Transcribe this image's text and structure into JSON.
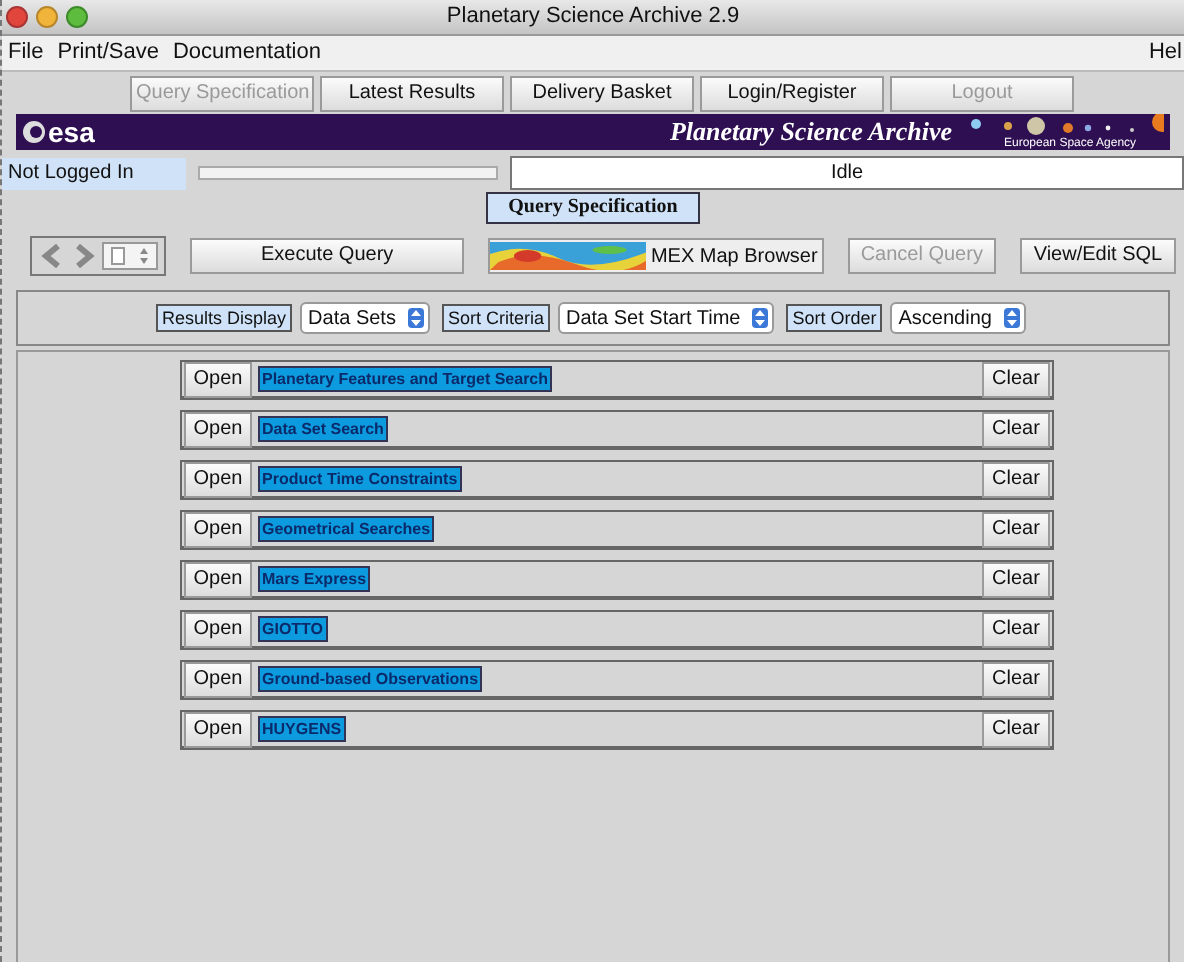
{
  "window": {
    "title": "Planetary Science Archive 2.9"
  },
  "menu": [
    {
      "label": "File"
    },
    {
      "label": "Print/Save"
    },
    {
      "label": "Documentation"
    }
  ],
  "help_menu": "Hel",
  "nav_buttons": [
    {
      "label": "Query Specification",
      "disabled": true
    },
    {
      "label": "Latest Results",
      "disabled": false
    },
    {
      "label": "Delivery Basket",
      "disabled": false
    },
    {
      "label": "Login/Register",
      "disabled": false
    },
    {
      "label": "Logout",
      "disabled": true
    }
  ],
  "banner": {
    "logo": "esa",
    "title": "Planetary Science  Archive",
    "agency": "European Space Agency"
  },
  "status": {
    "login": "Not Logged In",
    "progress": {
      "level": 0
    },
    "state": "Idle"
  },
  "panel_title": "Query Specification",
  "toolbar": {
    "execute": "Execute Query",
    "map_browser": "MEX Map Browser",
    "cancel": {
      "label": "Cancel Query",
      "disabled": true
    },
    "sql": "View/Edit SQL"
  },
  "sort_bar": [
    {
      "label": "Results Display",
      "value": "Data Sets"
    },
    {
      "label": "Sort Criteria",
      "value": "Data Set Start Time"
    },
    {
      "label": "Sort Order",
      "value": "Ascending"
    }
  ],
  "sections": [
    {
      "open": "Open",
      "title": "Planetary Features and Target Search",
      "clear": "Clear"
    },
    {
      "open": "Open",
      "title": "Data Set Search",
      "clear": "Clear"
    },
    {
      "open": "Open",
      "title": "Product Time Constraints",
      "clear": "Clear"
    },
    {
      "open": "Open",
      "title": "Geometrical Searches",
      "clear": "Clear"
    },
    {
      "open": "Open",
      "title": "Mars Express",
      "clear": "Clear"
    },
    {
      "open": "Open",
      "title": "GIOTTO",
      "clear": "Clear"
    },
    {
      "open": "Open",
      "title": "Ground-based Observations",
      "clear": "Clear"
    },
    {
      "open": "Open",
      "title": "HUYGENS",
      "clear": "Clear"
    }
  ]
}
